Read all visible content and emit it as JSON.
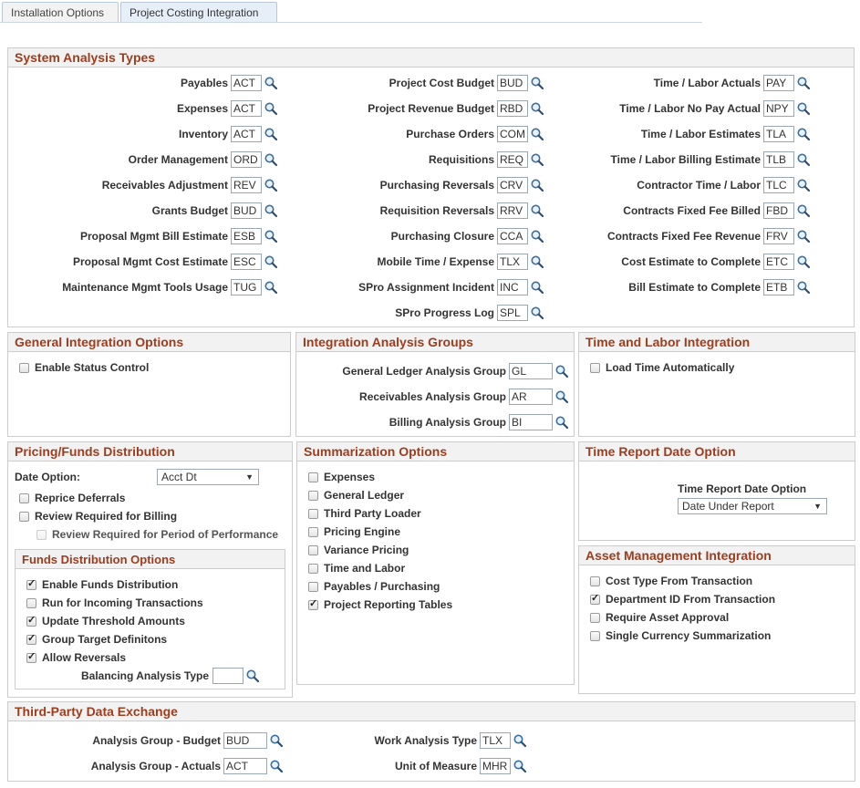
{
  "tabs": [
    {
      "label": "Installation Options"
    },
    {
      "label": "Project Costing Integration"
    }
  ],
  "system_analysis": {
    "title": "System Analysis Types",
    "col1": [
      {
        "label": "Payables",
        "value": "ACT"
      },
      {
        "label": "Expenses",
        "value": "ACT"
      },
      {
        "label": "Inventory",
        "value": "ACT"
      },
      {
        "label": "Order Management",
        "value": "ORD"
      },
      {
        "label": "Receivables Adjustment",
        "value": "REV"
      },
      {
        "label": "Grants Budget",
        "value": "BUD"
      },
      {
        "label": "Proposal Mgmt Bill Estimate",
        "value": "ESB"
      },
      {
        "label": "Proposal Mgmt Cost Estimate",
        "value": "ESC"
      },
      {
        "label": "Maintenance Mgmt Tools Usage",
        "value": "TUG"
      }
    ],
    "col2": [
      {
        "label": "Project Cost Budget",
        "value": "BUD"
      },
      {
        "label": "Project Revenue Budget",
        "value": "RBD"
      },
      {
        "label": "Purchase Orders",
        "value": "COM"
      },
      {
        "label": "Requisitions",
        "value": "REQ"
      },
      {
        "label": "Purchasing Reversals",
        "value": "CRV"
      },
      {
        "label": "Requisition Reversals",
        "value": "RRV"
      },
      {
        "label": "Purchasing Closure",
        "value": "CCA"
      },
      {
        "label": "Mobile Time / Expense",
        "value": "TLX"
      },
      {
        "label": "SPro Assignment Incident",
        "value": "INC"
      },
      {
        "label": "SPro Progress Log",
        "value": "SPL"
      }
    ],
    "col3": [
      {
        "label": "Time / Labor Actuals",
        "value": "PAY"
      },
      {
        "label": "Time / Labor No Pay Actual",
        "value": "NPY"
      },
      {
        "label": "Time / Labor Estimates",
        "value": "TLA"
      },
      {
        "label": "Time / Labor Billing Estimate",
        "value": "TLB"
      },
      {
        "label": "Contractor Time / Labor",
        "value": "TLC"
      },
      {
        "label": "Contracts Fixed Fee Billed",
        "value": "FBD"
      },
      {
        "label": "Contracts Fixed Fee Revenue",
        "value": "FRV"
      },
      {
        "label": "Cost Estimate to Complete",
        "value": "ETC"
      },
      {
        "label": "Bill Estimate to Complete",
        "value": "ETB"
      }
    ]
  },
  "general": {
    "title": "General Integration Options",
    "enable_status_control": "Enable Status Control",
    "enable_status_control_checked": false
  },
  "groups": {
    "title": "Integration Analysis Groups",
    "items": [
      {
        "label": "General Ledger Analysis Group",
        "value": "GL"
      },
      {
        "label": "Receivables Analysis Group",
        "value": "AR"
      },
      {
        "label": "Billing Analysis Group",
        "value": "BI"
      }
    ]
  },
  "time_labor": {
    "title": "Time and Labor Integration",
    "load_time": "Load Time Automatically",
    "load_time_checked": false
  },
  "pricing": {
    "title": "Pricing/Funds Distribution",
    "date_option_label": "Date Option:",
    "date_option_value": "Acct Dt",
    "reprice": "Reprice Deferrals",
    "review_billing": "Review Required for Billing",
    "review_pop": "Review Required for Period of Performance"
  },
  "funds": {
    "title": "Funds Distribution Options",
    "items": [
      {
        "label": "Enable Funds Distribution",
        "checked": true
      },
      {
        "label": "Run for Incoming Transactions",
        "checked": false
      },
      {
        "label": "Update Threshold Amounts",
        "checked": true
      },
      {
        "label": "Group Target Definitons",
        "checked": true
      },
      {
        "label": "Allow Reversals",
        "checked": true
      }
    ],
    "balancing_label": "Balancing Analysis Type",
    "balancing_value": ""
  },
  "summarization": {
    "title": "Summarization Options",
    "items": [
      {
        "label": "Expenses",
        "checked": false
      },
      {
        "label": "General Ledger",
        "checked": false
      },
      {
        "label": "Third Party Loader",
        "checked": false
      },
      {
        "label": "Pricing Engine",
        "checked": false
      },
      {
        "label": "Variance Pricing",
        "checked": false
      },
      {
        "label": "Time and Labor",
        "checked": false
      },
      {
        "label": "Payables / Purchasing",
        "checked": false
      },
      {
        "label": "Project Reporting Tables",
        "checked": true
      }
    ]
  },
  "time_report": {
    "title": "Time Report Date Option",
    "label": "Time Report Date Option",
    "value": "Date Under Report"
  },
  "asset": {
    "title": "Asset Management Integration",
    "items": [
      {
        "label": "Cost Type From Transaction",
        "checked": false
      },
      {
        "label": "Department ID From Transaction",
        "checked": true
      },
      {
        "label": "Require Asset Approval",
        "checked": false
      },
      {
        "label": "Single Currency Summarization",
        "checked": false
      }
    ]
  },
  "third_party": {
    "title": "Third-Party Data Exchange",
    "left": [
      {
        "label": "Analysis Group - Budget",
        "value": "BUD"
      },
      {
        "label": "Analysis Group - Actuals",
        "value": "ACT"
      }
    ],
    "right": [
      {
        "label": "Work Analysis Type",
        "value": "TLX"
      },
      {
        "label": "Unit of Measure",
        "value": "MHR"
      }
    ]
  }
}
